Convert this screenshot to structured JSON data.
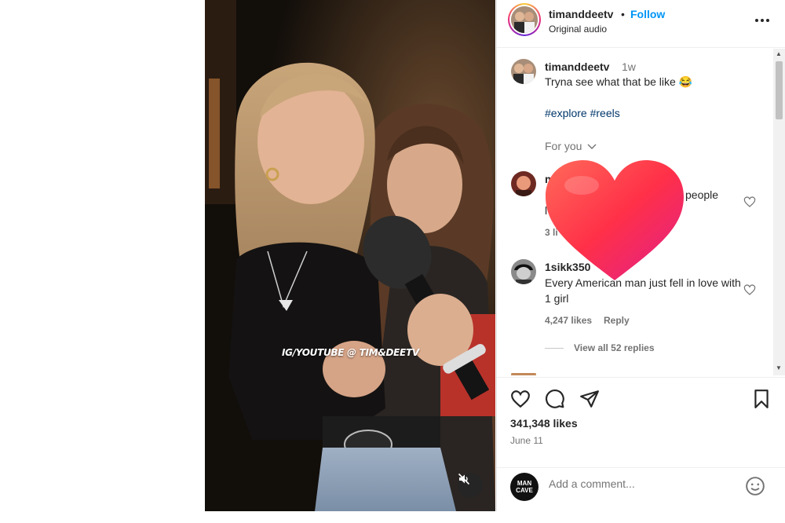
{
  "video": {
    "watermark": "IG/YOUTUBE @ TIM&DEETV",
    "mute_icon": "speaker-muted-icon"
  },
  "header": {
    "username": "timanddeetv",
    "separator": "•",
    "follow_label": "Follow",
    "audio": "Original audio",
    "more_icon": "more-horizontal-icon"
  },
  "caption": {
    "username": "timanddeetv",
    "time": "1w",
    "text": "Tryna see what that be like 😂",
    "hashtags": "#explore #reels",
    "for_you": "For you"
  },
  "comments": [
    {
      "username": "m",
      "text_line1": "people",
      "text_line2": "l",
      "meta": "3 li"
    },
    {
      "username": "1sikk350",
      "text": "Every American man just fell in love with 1 girl",
      "likes": "4,247 likes",
      "reply": "Reply",
      "view_replies": "View all 52 replies"
    }
  ],
  "actions": {
    "likes": "341,348 likes",
    "date": "June 11"
  },
  "add_comment": {
    "logo_line1": "MAN",
    "logo_line2": "CAVE",
    "placeholder": "Add a comment..."
  },
  "colors": {
    "accent": "#0095f6",
    "hashtag": "#00376b",
    "muted_text": "#737373",
    "like_heart": "#ff3040"
  }
}
